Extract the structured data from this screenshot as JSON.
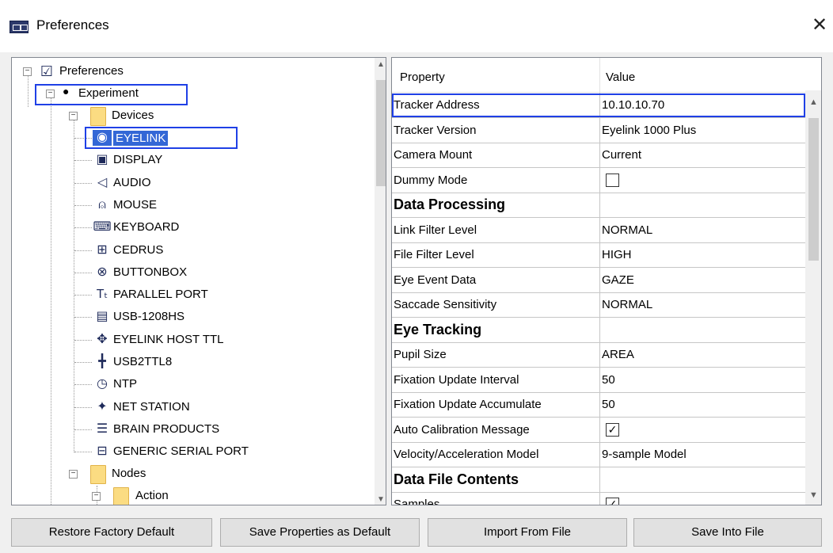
{
  "window": {
    "title": "Preferences",
    "close_glyph": "✕"
  },
  "tree": {
    "root": "Preferences",
    "experiment": "Experiment",
    "devices": "Devices",
    "device_items": [
      {
        "label": "EYELINK",
        "icon": "eye-icon"
      },
      {
        "label": "DISPLAY",
        "icon": "monitor-icon"
      },
      {
        "label": "AUDIO",
        "icon": "speaker-icon"
      },
      {
        "label": "MOUSE",
        "icon": "mouse-icon"
      },
      {
        "label": "KEYBOARD",
        "icon": "keyboard-icon"
      },
      {
        "label": "CEDRUS",
        "icon": "cedrus-icon"
      },
      {
        "label": "BUTTONBOX",
        "icon": "gamepad-icon"
      },
      {
        "label": "PARALLEL PORT",
        "icon": "ttl-icon"
      },
      {
        "label": "USB-1208HS",
        "icon": "usb-device-icon"
      },
      {
        "label": "EYELINK HOST TTL",
        "icon": "host-ttl-icon"
      },
      {
        "label": "USB2TTL8",
        "icon": "usb2ttl-icon"
      },
      {
        "label": "NTP",
        "icon": "clock-icon"
      },
      {
        "label": "NET STATION",
        "icon": "network-icon"
      },
      {
        "label": "BRAIN PRODUCTS",
        "icon": "brain-products-icon"
      },
      {
        "label": "GENERIC SERIAL PORT",
        "icon": "serial-port-icon"
      }
    ],
    "nodes": "Nodes",
    "action": "Action"
  },
  "properties": {
    "header": {
      "property": "Property",
      "value": "Value"
    },
    "rows": [
      {
        "key": "Tracker Address",
        "value": "10.10.10.70"
      },
      {
        "key": "Tracker Version",
        "value": "Eyelink 1000 Plus"
      },
      {
        "key": "Camera Mount",
        "value": "Current"
      },
      {
        "key": "Dummy Mode",
        "value": "",
        "checkbox": false
      },
      {
        "key": "Data Processing",
        "section": true
      },
      {
        "key": "Link Filter Level",
        "value": "NORMAL"
      },
      {
        "key": "File Filter Level",
        "value": "HIGH"
      },
      {
        "key": "Eye Event Data",
        "value": "GAZE"
      },
      {
        "key": "Saccade Sensitivity",
        "value": "NORMAL"
      },
      {
        "key": "Eye Tracking",
        "section": true
      },
      {
        "key": "Pupil Size",
        "value": "AREA"
      },
      {
        "key": "Fixation Update Interval",
        "value": "50"
      },
      {
        "key": "Fixation Update Accumulate",
        "value": "50"
      },
      {
        "key": "Auto Calibration Message",
        "value": "",
        "checkbox": true
      },
      {
        "key": "Velocity/Acceleration Model",
        "value": "9-sample Model"
      },
      {
        "key": "Data File Contents",
        "section": true
      },
      {
        "key": "Samples",
        "value": "",
        "checkbox": true
      }
    ]
  },
  "buttons": {
    "restore": "Restore Factory Default",
    "save_default": "Save Properties as Default",
    "import": "Import From File",
    "save_file": "Save Into File"
  },
  "colors": {
    "selection": "#3367d6",
    "highlight_box": "#1f40e6",
    "folder": "#fbdc82"
  }
}
